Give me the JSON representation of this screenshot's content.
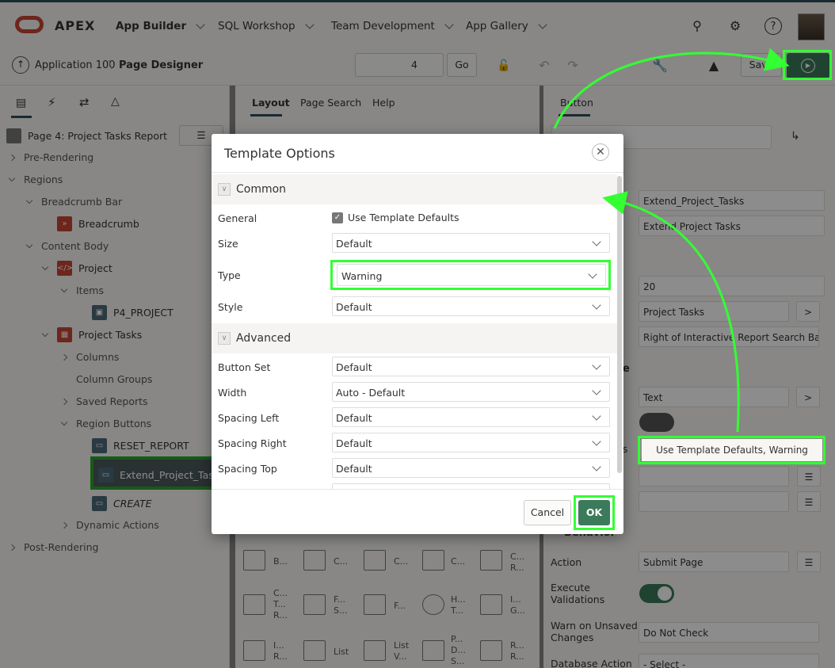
{
  "topbar": {
    "brand": "APEX",
    "nav": [
      "App Builder",
      "SQL Workshop",
      "Team Development",
      "App Gallery"
    ]
  },
  "subbar": {
    "app": "Application 100",
    "page": "Page Designer",
    "page_number": "4",
    "go": "Go",
    "save": "Save"
  },
  "left": {
    "page_title": "Page 4: Project Tasks Report",
    "tree": {
      "pre_rendering": "Pre-Rendering",
      "regions": "Regions",
      "breadcrumb_bar": "Breadcrumb Bar",
      "breadcrumb": "Breadcrumb",
      "content_body": "Content Body",
      "project": "Project",
      "items": "Items",
      "p4_project": "P4_PROJECT",
      "project_tasks": "Project Tasks",
      "columns": "Columns",
      "column_groups": "Column Groups",
      "saved_reports": "Saved Reports",
      "region_buttons": "Region Buttons",
      "reset_report": "RESET_REPORT",
      "extend": "Extend_Project_Tasks",
      "create": "CREATE",
      "dynamic_actions": "Dynamic Actions",
      "post_rendering": "Post-Rendering"
    }
  },
  "middle": {
    "tabs": [
      "Layout",
      "Page Search",
      "Help"
    ],
    "gallery": [
      "B...",
      "C...",
      "C...",
      "C...",
      "C...\nR...",
      "C...\nT...\nR...",
      "F...\nS...",
      "F...",
      "H...\nT...",
      "I...\nG...",
      "I...\nR...",
      "List",
      "List\nV...",
      "P...\nD...\nS...",
      "R...\nR..."
    ]
  },
  "right": {
    "tab": "Button",
    "fields": {
      "name": "Extend_Project_Tasks",
      "label": "Extend Project Tasks",
      "sequence": "20",
      "region": "Project Tasks",
      "position": "Right of Interactive Report Search Bar",
      "button_template": "Text",
      "template_options": "Use Template Defaults, Warning",
      "behavior": "Behavior",
      "action_label": "Action",
      "action": "Submit Page",
      "execute_validations": "Execute Validations",
      "warn_label": "Warn on Unsaved Changes",
      "warn": "Do Not Check",
      "db_action_label": "Database Action",
      "db_action": "- Select -"
    },
    "partial_labels": {
      "on": "on",
      "e": "e",
      "s": "s"
    }
  },
  "dialog": {
    "title": "Template Options",
    "common": "Common",
    "advanced": "Advanced",
    "general_label": "General",
    "use_defaults": "Use Template Defaults",
    "rows_common": [
      {
        "label": "Size",
        "value": "Default"
      },
      {
        "label": "Type",
        "value": "Warning"
      },
      {
        "label": "Style",
        "value": "Default"
      }
    ],
    "rows_advanced": [
      {
        "label": "Button Set",
        "value": "Default"
      },
      {
        "label": "Width",
        "value": "Auto - Default"
      },
      {
        "label": "Spacing Left",
        "value": "Default"
      },
      {
        "label": "Spacing Right",
        "value": "Default"
      },
      {
        "label": "Spacing Top",
        "value": "Default"
      }
    ],
    "cancel": "Cancel",
    "ok": "OK"
  },
  "colors": {
    "highlight": "#33ff33",
    "ok_button": "#3b7a5a",
    "apex_red": "#c74634"
  }
}
